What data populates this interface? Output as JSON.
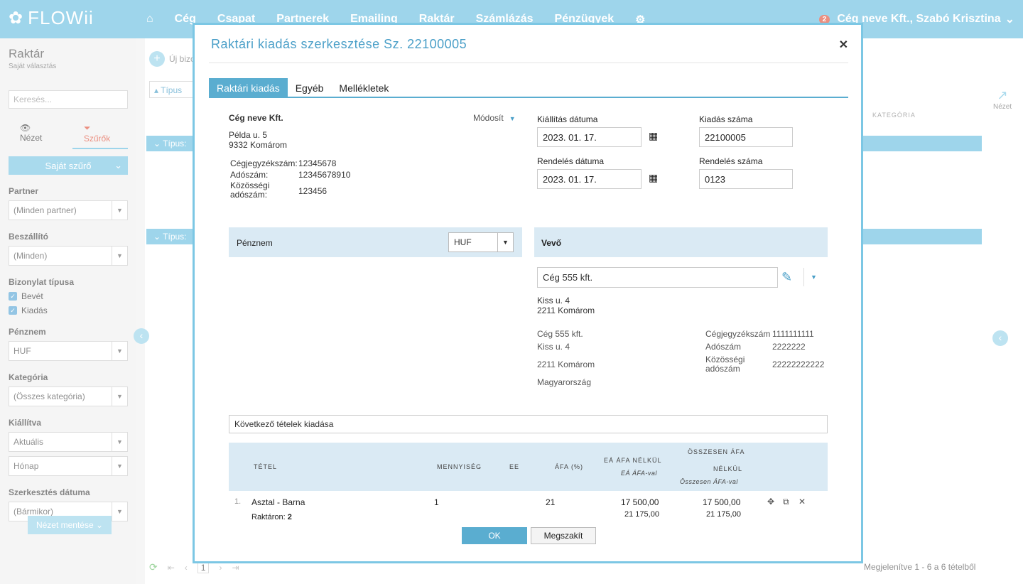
{
  "app": {
    "logo": "FLOWii",
    "nav": [
      "Cég",
      "Csapat",
      "Partnerek",
      "Emailing",
      "Raktár",
      "Számlázás",
      "Pénzügyek"
    ],
    "notification_count": "2",
    "user": "Cég neve Kft., Szabó Krisztina"
  },
  "sidebar": {
    "title": "Raktár",
    "subtitle": "Saját választás",
    "search_placeholder": "Keresés...",
    "tab_view": "Nézet",
    "tab_filters": "Szűrők",
    "own_filter": "Saját szűrő",
    "partner_label": "Partner",
    "partner_value": "(Minden partner)",
    "supplier_label": "Beszállító",
    "supplier_value": "(Minden)",
    "doctype_label": "Bizonylat típusa",
    "doctype_options": [
      "Bevét",
      "Kiadás"
    ],
    "currency_label": "Pénznem",
    "currency_value": "HUF",
    "category_label": "Kategória",
    "category_value": "(Összes kategória)",
    "issued_label": "Kiállítva",
    "issued_value1": "Aktuális",
    "issued_value2": "Hónap",
    "edited_label": "Szerkesztés dátuma",
    "edited_value": "(Bármikor)",
    "save_view": "Nézet mentése"
  },
  "main": {
    "new_doc": "Új bizo",
    "type_sort": "Típus",
    "group_label": "Típus:",
    "col_category": "KATEGÓRIA",
    "view": "Nézet",
    "page": "1",
    "footer": "Megjelenítve 1 - 6 a 6 tételből"
  },
  "modal": {
    "title": "Raktári kiadás szerkesztése Sz. 22100005",
    "tabs": [
      "Raktári kiadás",
      "Egyéb",
      "Mellékletek"
    ],
    "company": {
      "name": "Cég neve Kft.",
      "edit": "Módosít",
      "street": "Példa u. 5",
      "city": "9332 Komárom",
      "reg_label": "Cégjegyzékszám:",
      "reg_value": "12345678",
      "tax_label": "Adószám:",
      "tax_value": "12345678910",
      "eu_label1": "Közösségi",
      "eu_label2": "adószám:",
      "eu_value": "123456"
    },
    "fields": {
      "issue_date_label": "Kiállítás dátuma",
      "issue_date": "2023. 01. 17.",
      "doc_number_label": "Kiadás száma",
      "doc_number": "22100005",
      "order_date_label": "Rendelés dátuma",
      "order_date": "2023. 01. 17.",
      "order_number_label": "Rendelés száma",
      "order_number": "0123"
    },
    "currency": {
      "label": "Pénznem",
      "value": "HUF"
    },
    "buyer": {
      "label": "Vevő",
      "name": "Cég 555 kft.",
      "street": "Kiss u. 4",
      "city": "2211 Komárom",
      "d_name": "Cég 555 kft.",
      "d_street": "Kiss u. 4",
      "d_city": "2211 Komárom",
      "d_country": "Magyarország",
      "reg_label": "Cégjegyzékszám",
      "reg_value": "1111111111",
      "tax_label": "Adószám",
      "tax_value": "2222222",
      "eu_label1": "Közösségi",
      "eu_label2": "adószám",
      "eu_value": "22222222222"
    },
    "notes": "Következő tételek kiadása",
    "table": {
      "headers": {
        "item": "TÉTEL",
        "qty": "MENNYISÉG",
        "unit": "EE",
        "vat": "ÁFA (%)",
        "unit_net": "EÁ ÁFA NÉLKÜL",
        "unit_gross": "EÁ ÁFA-val",
        "total_net1": "ÖSSZESEN ÁFA",
        "total_net2": "NÉLKÜL",
        "total_gross": "Összesen ÁFA-val"
      },
      "rows": [
        {
          "index": "1.",
          "name": "Asztal - Barna",
          "stock_label": "Raktáron:",
          "stock": "2",
          "qty": "1",
          "vat": "21",
          "unit_net": "17 500,00",
          "unit_gross": "21 175,00",
          "total_net": "17 500,00",
          "total_gross": "21 175,00"
        }
      ]
    },
    "ok": "OK",
    "cancel": "Megszakít"
  },
  "colors": {
    "accent": "#5aadd0",
    "nav": "#6bbfe0",
    "band": "#daeaf4",
    "danger": "#e0533d"
  }
}
